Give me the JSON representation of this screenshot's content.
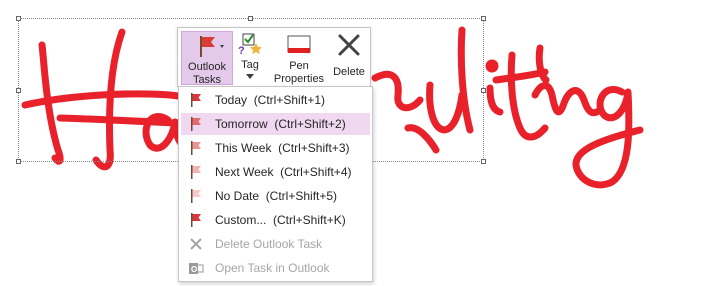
{
  "ink": {
    "word": "Handwriting",
    "color": "#e8212b"
  },
  "toolbar": {
    "outlook_tasks": {
      "line1": "Outlook",
      "line2": "Tasks",
      "icon": "flag-icon"
    },
    "tag": {
      "label": "Tag",
      "icon": "tag-icon"
    },
    "pen_properties": {
      "line1": "Pen",
      "line2": "Properties",
      "icon": "pen-properties-icon"
    },
    "delete": {
      "label": "Delete",
      "icon": "delete-icon"
    }
  },
  "menu": {
    "items": [
      {
        "label": "Today  (Ctrl+Shift+1)",
        "icon": "flag-today-icon",
        "flag_color": "#d9363e",
        "state": "normal"
      },
      {
        "label": "Tomorrow  (Ctrl+Shift+2)",
        "icon": "flag-tomorrow-icon",
        "flag_color": "#e36a6a",
        "state": "hover"
      },
      {
        "label": "This Week  (Ctrl+Shift+3)",
        "icon": "flag-this-week-icon",
        "flag_color": "#ec9494",
        "state": "normal"
      },
      {
        "label": "Next Week  (Ctrl+Shift+4)",
        "icon": "flag-next-week-icon",
        "flag_color": "#f2b3b3",
        "state": "normal"
      },
      {
        "label": "No Date  (Ctrl+Shift+5)",
        "icon": "flag-no-date-icon",
        "flag_color": "#f6caca",
        "state": "normal"
      },
      {
        "label": "Custom...  (Ctrl+Shift+K)",
        "icon": "flag-custom-icon",
        "flag_color": "#d9363e",
        "state": "normal"
      },
      {
        "label": "Delete Outlook Task",
        "icon": "delete-task-icon",
        "state": "disabled"
      },
      {
        "label": "Open Task in Outlook",
        "icon": "outlook-icon",
        "state": "disabled"
      }
    ]
  },
  "colors": {
    "active_button": "#e3c9ea",
    "menu_hover": "#efd8f0",
    "disabled_text": "#a6a6a6"
  }
}
